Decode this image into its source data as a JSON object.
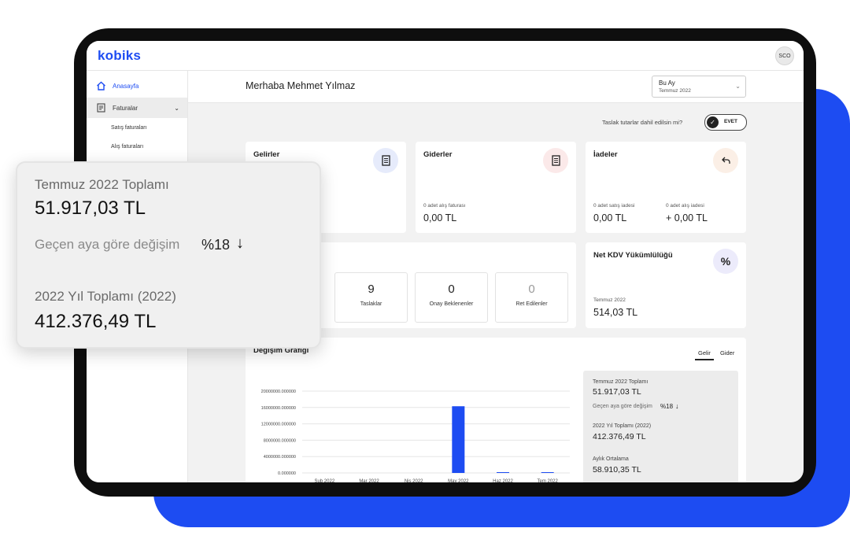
{
  "app": {
    "logo": "kobiks",
    "user_initials": "SCO"
  },
  "sidebar": {
    "items": [
      {
        "label": "Anasayfa",
        "icon": "home-icon"
      },
      {
        "label": "Faturalar",
        "icon": "invoice-icon"
      }
    ],
    "subitems": [
      "Satış faturaları",
      "Alış faturaları"
    ]
  },
  "header": {
    "greeting": "Merhaba Mehmet Yılmaz",
    "period_label": "Bu Ay",
    "period_value": "Temmuz 2022"
  },
  "toggle": {
    "label": "Taslak tutarlar dahil edilsin mi?",
    "state": "EVET"
  },
  "cards": {
    "gelirler": {
      "title": "Gelirler",
      "icon": "receipt-icon",
      "color": "#e6ebfb"
    },
    "giderler": {
      "title": "Giderler",
      "icon": "receipt-icon",
      "color": "#fbe9e9",
      "note": "0 adet alış faturası",
      "amount": "0,00 TL"
    },
    "iadeler": {
      "title": "İadeler",
      "icon": "undo-icon",
      "color": "#fbefe6",
      "left_note": "0 adet satış iadesi",
      "left_amount": "0,00 TL",
      "right_note": "0 adet alış iadesi",
      "right_amount": "+ 0,00 TL"
    },
    "kdv": {
      "title": "Net KDV Yükümlülüğü",
      "icon": "percent-icon",
      "color": "#ecebfb",
      "note": "Temmuz 2022",
      "amount": "514,03 TL"
    }
  },
  "stats": [
    {
      "value": "9",
      "label": "Taslaklar"
    },
    {
      "value": "0",
      "label": "Onay Beklenenler"
    },
    {
      "value": "0",
      "label": "Ret Edilenler"
    }
  ],
  "chart_section": {
    "title": "Değişim Grafiği",
    "tabs": [
      "Gelir",
      "Gider"
    ],
    "active_tab": "Gelir"
  },
  "chart_data": {
    "type": "bar",
    "categories": [
      "Şub 2022",
      "Mar 2022",
      "Nis 2022",
      "May 2022",
      "Haz 2022",
      "Tem 2022"
    ],
    "values": [
      0,
      0,
      0,
      16300000,
      51917.03,
      51917.03
    ],
    "ylim": [
      0,
      20000000
    ],
    "yticks": [
      "20000000.000000",
      "16000000.000000",
      "12000000.000000",
      "8000000.000000",
      "4000000.000000",
      "0.000000"
    ],
    "color": "#1d4cf2",
    "grid": true
  },
  "summary": {
    "month_label": "Temmuz 2022 Toplamı",
    "month_value": "51.917,03 TL",
    "change_label": "Geçen aya göre değişim",
    "change_value": "%18",
    "year_label": "2022 Yıl Toplamı (2022)",
    "year_value": "412.376,49 TL",
    "avg_label": "Aylık Ortalama",
    "avg_value": "58.910,35 TL"
  },
  "overlay": {
    "month_label": "Temmuz 2022 Toplamı",
    "month_value": "51.917,03 TL",
    "change_label": "Geçen aya göre değişim",
    "change_value": "%18",
    "year_label": "2022 Yıl Toplamı (2022)",
    "year_value": "412.376,49 TL"
  }
}
